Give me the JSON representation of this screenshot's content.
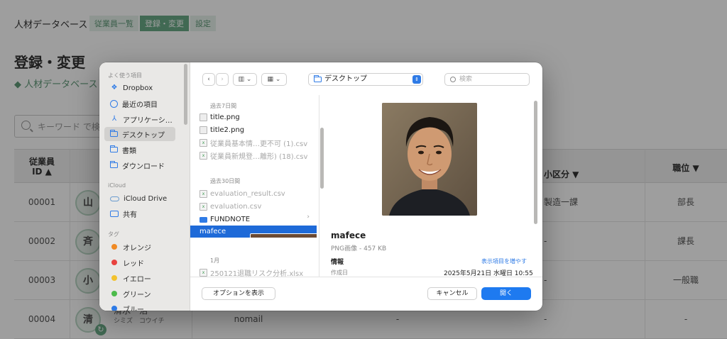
{
  "app": {
    "title": "人材データベース",
    "tabs": [
      "従業員一覧",
      "登録・変更",
      "設定"
    ],
    "page_title": "登録・変更",
    "sub_title": "◆ 人材データベース",
    "search_placeholder": "キーワード で検索",
    "table": {
      "header_id": "従業員",
      "header_id2": "ID ▲",
      "header_sub": "小区分 ▼",
      "header_pos": "職位 ▼",
      "rows": [
        {
          "id": "00001",
          "avatar": "山",
          "sub": "製造一課",
          "pos": "部長"
        },
        {
          "id": "00002",
          "avatar": "斉",
          "sub": "-",
          "pos": "課長"
        },
        {
          "id": "00003",
          "avatar": "小",
          "sub": "-",
          "pos": "一般職"
        },
        {
          "id": "00004",
          "avatar": "清",
          "name": "清水　浩一",
          "kana": "シミズ　コウイチ",
          "mail": "nomail",
          "dash": "-",
          "sub": "-",
          "pos": "-"
        }
      ]
    }
  },
  "dialog": {
    "sidebar": {
      "favorites_header": "よく使う項目",
      "items": [
        "Dropbox",
        "最近の項目",
        "アプリケーシ…",
        "デスクトップ",
        "書類",
        "ダウンロード"
      ],
      "icloud_header": "iCloud",
      "icloud_items": [
        "iCloud Drive",
        "共有"
      ],
      "tags_header": "タグ",
      "tags": [
        {
          "label": "オレンジ",
          "color": "#f08a24"
        },
        {
          "label": "レッド",
          "color": "#e8423f"
        },
        {
          "label": "イエロー",
          "color": "#f3c22d"
        },
        {
          "label": "グリーン",
          "color": "#4cbb4a"
        },
        {
          "label": "ブルー",
          "color": "#2f7be6"
        }
      ]
    },
    "toolbar": {
      "back": "‹",
      "forward": "›",
      "view_columns": "▥ ⌄",
      "view_grid": "▦ ⌄",
      "location": "デスクトップ",
      "search_placeholder": "検索"
    },
    "files": {
      "section_7days": "過去7日間",
      "section_30days": "過去30日間",
      "section_jan": "1月",
      "items_7days": [
        "title.png",
        "title2.png",
        "従業員基本情…更不可 (1).csv",
        "従業員新規登…離形) (18).csv"
      ],
      "items_30days": [
        "evaluation_result.csv",
        "evaluation.csv",
        "FUNDNOTE",
        "mafece"
      ],
      "items_jan": [
        "250121退職リスク分析.xlsx"
      ]
    },
    "preview": {
      "name": "mafece",
      "kind": "PNG画像 - 457 KB",
      "info_label": "情報",
      "show_more": "表示項目を増やす",
      "created_label": "作成日",
      "created_value": "2025年5月21日 水曜日 10:55"
    },
    "footer": {
      "options": "オプションを表示",
      "cancel": "キャンセル",
      "open": "開く"
    }
  }
}
